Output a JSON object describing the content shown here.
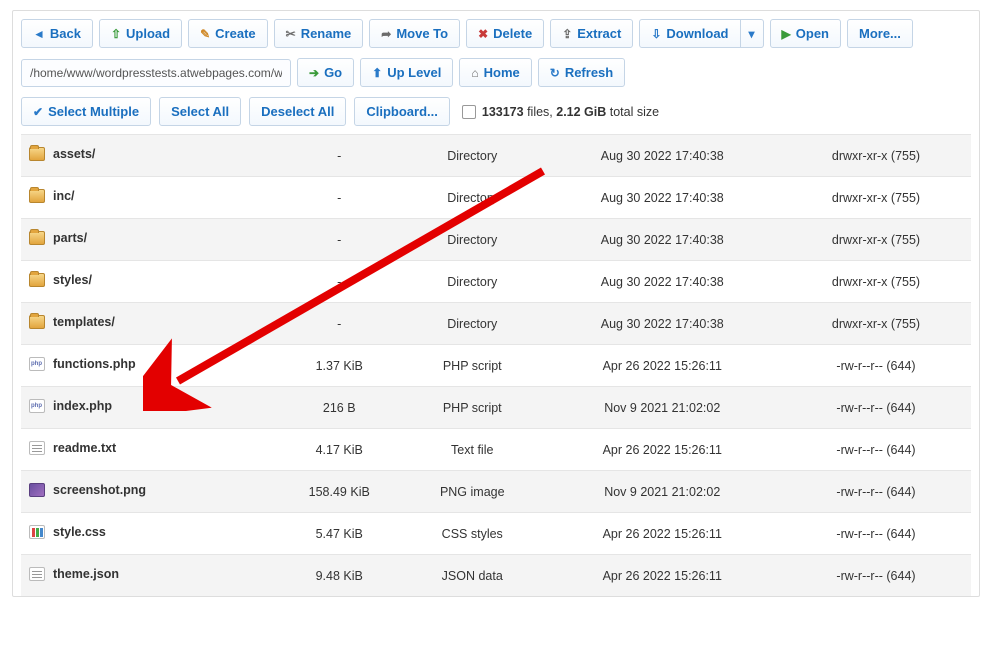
{
  "toolbar": {
    "back": "Back",
    "upload": "Upload",
    "create": "Create",
    "rename": "Rename",
    "moveto": "Move To",
    "delete": "Delete",
    "extract": "Extract",
    "download": "Download",
    "open": "Open",
    "more": "More..."
  },
  "path": {
    "value": "/home/www/wordpresstests.atwebpages.com/wp-content",
    "go": "Go",
    "uplevel": "Up Level",
    "home": "Home",
    "refresh": "Refresh"
  },
  "select": {
    "multiple": "Select Multiple",
    "selectall": "Select All",
    "deselectall": "Deselect All",
    "clipboard": "Clipboard..."
  },
  "stats": {
    "count": "133173",
    "files_text": " files, ",
    "size": "2.12 GiB",
    "size_suffix": " total size"
  },
  "rows": [
    {
      "icon": "folder",
      "name": "assets/",
      "size": "-",
      "type": "Directory",
      "date": "Aug 30 2022 17:40:38",
      "perm": "drwxr-xr-x (755)"
    },
    {
      "icon": "folder",
      "name": "inc/",
      "size": "-",
      "type": "Directory",
      "date": "Aug 30 2022 17:40:38",
      "perm": "drwxr-xr-x (755)"
    },
    {
      "icon": "folder",
      "name": "parts/",
      "size": "-",
      "type": "Directory",
      "date": "Aug 30 2022 17:40:38",
      "perm": "drwxr-xr-x (755)"
    },
    {
      "icon": "folder",
      "name": "styles/",
      "size": "-",
      "type": "Directory",
      "date": "Aug 30 2022 17:40:38",
      "perm": "drwxr-xr-x (755)"
    },
    {
      "icon": "folder",
      "name": "templates/",
      "size": "-",
      "type": "Directory",
      "date": "Aug 30 2022 17:40:38",
      "perm": "drwxr-xr-x (755)"
    },
    {
      "icon": "php",
      "name": "functions.php",
      "size": "1.37 KiB",
      "type": "PHP script",
      "date": "Apr 26 2022 15:26:11",
      "perm": "-rw-r--r-- (644)"
    },
    {
      "icon": "php",
      "name": "index.php",
      "size": "216 B",
      "type": "PHP script",
      "date": "Nov 9 2021 21:02:02",
      "perm": "-rw-r--r-- (644)"
    },
    {
      "icon": "txt",
      "name": "readme.txt",
      "size": "4.17 KiB",
      "type": "Text file",
      "date": "Apr 26 2022 15:26:11",
      "perm": "-rw-r--r-- (644)"
    },
    {
      "icon": "png",
      "name": "screenshot.png",
      "size": "158.49 KiB",
      "type": "PNG image",
      "date": "Nov 9 2021 21:02:02",
      "perm": "-rw-r--r-- (644)"
    },
    {
      "icon": "css",
      "name": "style.css",
      "size": "5.47 KiB",
      "type": "CSS styles",
      "date": "Apr 26 2022 15:26:11",
      "perm": "-rw-r--r-- (644)"
    },
    {
      "icon": "json",
      "name": "theme.json",
      "size": "9.48 KiB",
      "type": "JSON data",
      "date": "Apr 26 2022 15:26:11",
      "perm": "-rw-r--r-- (644)"
    }
  ]
}
